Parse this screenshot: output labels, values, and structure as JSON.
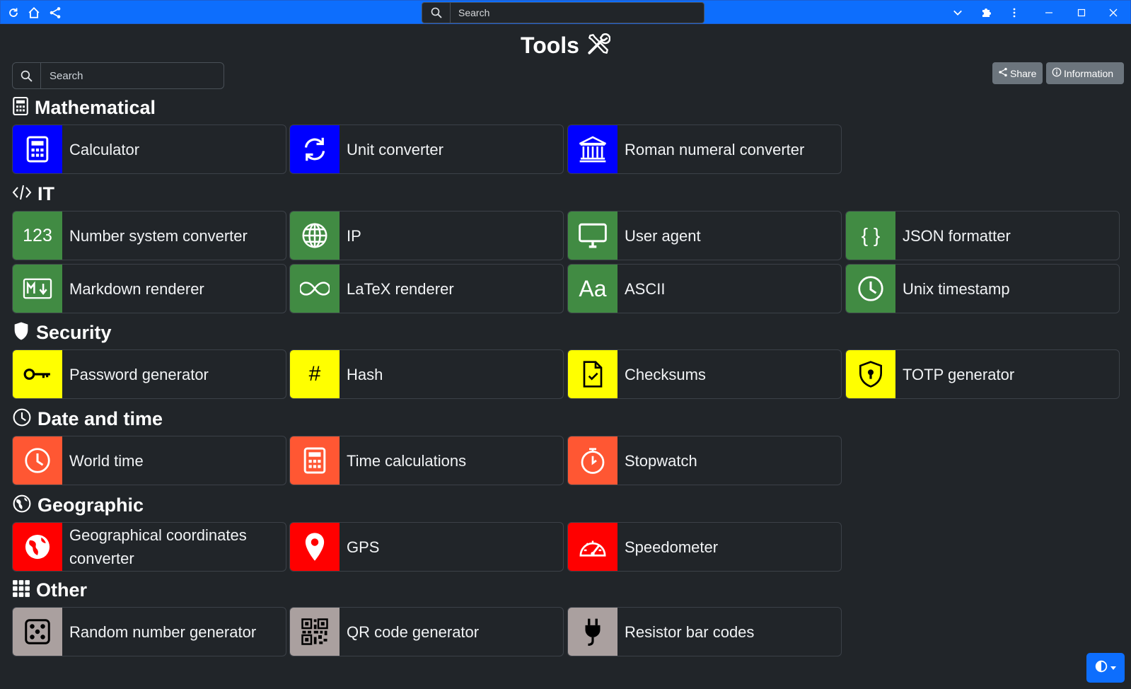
{
  "titlebar": {
    "search_placeholder": "Search",
    "icons": [
      "reload-icon",
      "home-icon",
      "share-icon",
      "chevron-down-icon",
      "puzzle-icon",
      "kebab-menu-icon",
      "minimize-icon",
      "maximize-icon",
      "close-icon"
    ]
  },
  "page": {
    "title": "Tools",
    "title_icon": "tools-icon",
    "search_placeholder": "Search",
    "share_label": "Share",
    "information_label": "Information"
  },
  "sections": {
    "mathematical": {
      "label": "Mathematical",
      "icon": "calculator-icon",
      "cards": [
        {
          "label": "Calculator",
          "icon": "calculator-icon"
        },
        {
          "label": "Unit converter",
          "icon": "arrows-cycle-icon"
        },
        {
          "label": "Roman numeral converter",
          "icon": "building-columns-icon"
        }
      ]
    },
    "it": {
      "label": "IT",
      "icon": "code-slash-icon",
      "cards": [
        {
          "label": "Number system converter",
          "icon": "123-icon",
          "icon_text": "123"
        },
        {
          "label": "IP",
          "icon": "globe-icon"
        },
        {
          "label": "User agent",
          "icon": "monitor-icon"
        },
        {
          "label": "JSON formatter",
          "icon": "braces-icon",
          "icon_text": "{ }"
        },
        {
          "label": "Markdown renderer",
          "icon": "markdown-icon"
        },
        {
          "label": "LaTeX renderer",
          "icon": "infinity-icon"
        },
        {
          "label": "ASCII",
          "icon": "fonts-icon",
          "icon_text": "Aa"
        },
        {
          "label": "Unix timestamp",
          "icon": "clock-icon"
        }
      ]
    },
    "security": {
      "label": "Security",
      "icon": "shield-icon",
      "cards": [
        {
          "label": "Password generator",
          "icon": "key-icon"
        },
        {
          "label": "Hash",
          "icon": "hash-icon",
          "icon_text": "#"
        },
        {
          "label": "Checksums",
          "icon": "file-check-icon"
        },
        {
          "label": "TOTP generator",
          "icon": "shield-lock-icon"
        }
      ]
    },
    "datetime": {
      "label": "Date and time",
      "icon": "clock-icon",
      "cards": [
        {
          "label": "World time",
          "icon": "clock-icon"
        },
        {
          "label": "Time calculations",
          "icon": "calculator-icon"
        },
        {
          "label": "Stopwatch",
          "icon": "stopwatch-icon"
        }
      ]
    },
    "geographic": {
      "label": "Geographic",
      "icon": "globe-americas-icon",
      "cards": [
        {
          "label": "Geographical coordinates converter",
          "icon": "globe-americas-icon"
        },
        {
          "label": "GPS",
          "icon": "geo-pin-icon"
        },
        {
          "label": "Speedometer",
          "icon": "speedometer-icon"
        }
      ]
    },
    "other": {
      "label": "Other",
      "icon": "grid-icon",
      "cards": [
        {
          "label": "Random number generator",
          "icon": "dice-icon"
        },
        {
          "label": "QR code generator",
          "icon": "qr-code-icon"
        },
        {
          "label": "Resistor bar codes",
          "icon": "plug-icon"
        }
      ]
    }
  },
  "colors": {
    "background": "#212529",
    "titlebar": "#0d6efd",
    "mathematical": "#0000ff",
    "it": "#418b43",
    "security": "#ffff00",
    "datetime": "#ff5733",
    "geographic": "#ff0000",
    "other": "#aaa09f"
  },
  "theme_toggle_icon": "circle-half-icon"
}
